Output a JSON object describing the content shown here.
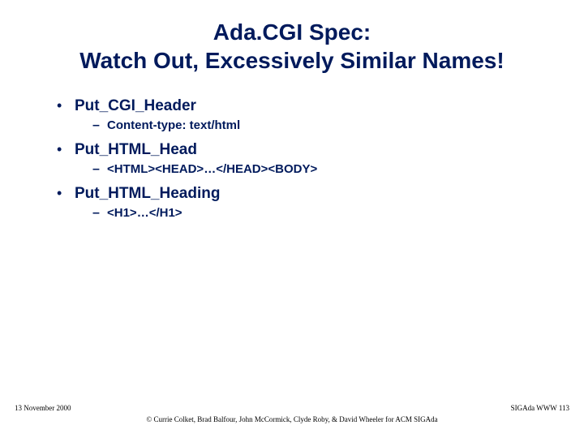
{
  "title": "Ada.CGI Spec:\nWatch Out, Excessively Similar Names!",
  "bullets": [
    {
      "text": "Put_CGI_Header",
      "sub": "Content-type: text/html"
    },
    {
      "text": "Put_HTML_Head",
      "sub": "<HTML><HEAD>…</HEAD><BODY>"
    },
    {
      "text": "Put_HTML_Heading",
      "sub": "<H1>…</H1>"
    }
  ],
  "footer": {
    "left": "13 November 2000",
    "right": "SIGAda WWW 113",
    "center": "© Currie Colket, Brad Balfour, John McCormick, Clyde Roby, & David Wheeler for ACM SIGAda"
  }
}
